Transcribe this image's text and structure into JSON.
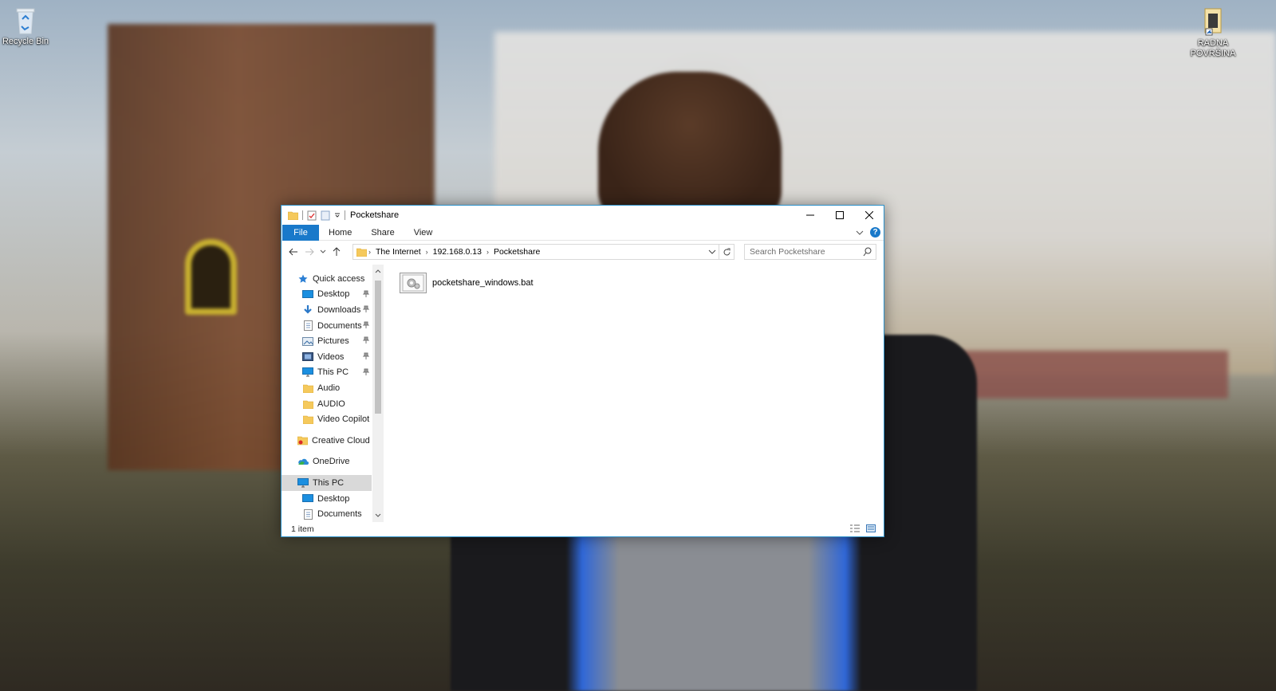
{
  "desktop": {
    "icons": [
      {
        "label": "Recycle Bin",
        "icon": "recycle-bin-icon"
      },
      {
        "label": "RADNA POVRŠINA",
        "icon": "folder-shortcut-icon"
      }
    ]
  },
  "window": {
    "title": "Pocketshare",
    "controls": {
      "minimize": "minimize-icon",
      "maximize": "maximize-icon",
      "close": "close-icon"
    }
  },
  "ribbon": {
    "tabs": [
      "File",
      "Home",
      "Share",
      "View"
    ]
  },
  "address_bar": {
    "crumbs": [
      "The Internet",
      "192.168.0.13",
      "Pocketshare"
    ]
  },
  "search": {
    "placeholder": "Search Pocketshare"
  },
  "nav_pane": {
    "quick_access": "Quick access",
    "items": [
      {
        "label": "Desktop",
        "icon": "desktop-icon",
        "pinned": true
      },
      {
        "label": "Downloads",
        "icon": "download-icon",
        "pinned": true
      },
      {
        "label": "Documents",
        "icon": "documents-icon",
        "pinned": true
      },
      {
        "label": "Pictures",
        "icon": "pictures-icon",
        "pinned": true
      },
      {
        "label": "Videos",
        "icon": "videos-icon",
        "pinned": true
      },
      {
        "label": "This PC",
        "icon": "computer-icon",
        "pinned": true
      },
      {
        "label": "Audio",
        "icon": "folder-icon",
        "pinned": false
      },
      {
        "label": "AUDIO",
        "icon": "folder-icon",
        "pinned": false
      },
      {
        "label": "Video Copilot",
        "icon": "folder-icon",
        "pinned": false
      }
    ],
    "creative_cloud": "Creative Cloud Fil",
    "onedrive": "OneDrive",
    "this_pc": "This PC",
    "this_pc_children": [
      "Desktop",
      "Documents"
    ]
  },
  "content": {
    "files": [
      {
        "name": "pocketshare_windows.bat",
        "icon": "batch-file-icon"
      }
    ]
  },
  "status": {
    "item_count": "1 item"
  },
  "colors": {
    "accent": "#1979ca",
    "window_border": "#2b90c9",
    "selection": "#d9d9d9"
  }
}
